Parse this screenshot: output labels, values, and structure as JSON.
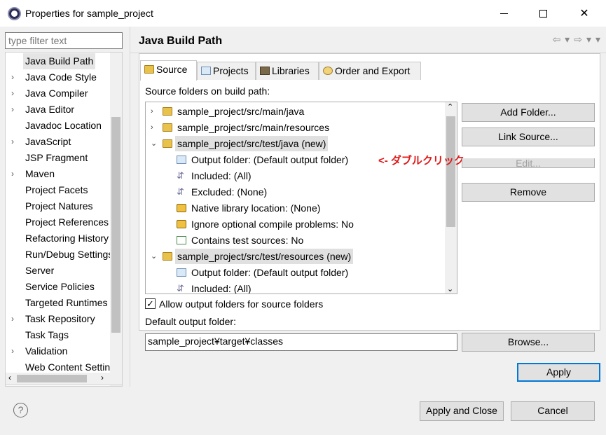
{
  "window": {
    "title": "Properties for sample_project",
    "minimize_icon": "minimize-icon",
    "maximize_icon": "maximize-icon",
    "close_icon": "close-icon"
  },
  "filter": {
    "placeholder": "type filter text"
  },
  "sidebar": {
    "items": [
      {
        "label": "Java Build Path",
        "expandable": false,
        "selected": true
      },
      {
        "label": "Java Code Style",
        "expandable": true
      },
      {
        "label": "Java Compiler",
        "expandable": true
      },
      {
        "label": "Java Editor",
        "expandable": true
      },
      {
        "label": "Javadoc Location",
        "expandable": false
      },
      {
        "label": "JavaScript",
        "expandable": true
      },
      {
        "label": "JSP Fragment",
        "expandable": false
      },
      {
        "label": "Maven",
        "expandable": true
      },
      {
        "label": "Project Facets",
        "expandable": false
      },
      {
        "label": "Project Natures",
        "expandable": false
      },
      {
        "label": "Project References",
        "expandable": false
      },
      {
        "label": "Refactoring History",
        "expandable": false
      },
      {
        "label": "Run/Debug Settings",
        "expandable": false
      },
      {
        "label": "Server",
        "expandable": false
      },
      {
        "label": "Service Policies",
        "expandable": false
      },
      {
        "label": "Targeted Runtimes",
        "expandable": false
      },
      {
        "label": "Task Repository",
        "expandable": true
      },
      {
        "label": "Task Tags",
        "expandable": false
      },
      {
        "label": "Validation",
        "expandable": true
      },
      {
        "label": "Web Content Settings",
        "expandable": false
      }
    ]
  },
  "page": {
    "title": "Java Build Path"
  },
  "tabs": [
    {
      "label": "Source",
      "active": true
    },
    {
      "label": "Projects"
    },
    {
      "label": "Libraries"
    },
    {
      "label": "Order and Export"
    }
  ],
  "source": {
    "section_label": "Source folders on build path:",
    "rows": [
      {
        "text": "sample_project/src/main/java",
        "level": 0,
        "expander": "›",
        "icon": "package-folder-icon"
      },
      {
        "text": "sample_project/src/main/resources",
        "level": 0,
        "expander": "›",
        "icon": "package-folder-icon"
      },
      {
        "text": "sample_project/src/test/java (new)",
        "level": 0,
        "expander": "⌄",
        "icon": "package-folder-icon",
        "highlighted": true
      },
      {
        "text": "Output folder: (Default output folder)",
        "level": 1,
        "icon": "output-folder-icon"
      },
      {
        "text": "Included: (All)",
        "level": 1,
        "icon": "filter-icon"
      },
      {
        "text": "Excluded: (None)",
        "level": 1,
        "icon": "filter-icon"
      },
      {
        "text": "Native library location: (None)",
        "level": 1,
        "icon": "native-library-icon"
      },
      {
        "text": "Ignore optional compile problems: No",
        "level": 1,
        "icon": "warning-ignore-icon"
      },
      {
        "text": "Contains test sources: No",
        "level": 1,
        "icon": "test-sources-icon"
      },
      {
        "text": "sample_project/src/test/resources (new)",
        "level": 0,
        "expander": "⌄",
        "icon": "package-folder-icon",
        "highlighted": true
      },
      {
        "text": "Output folder: (Default output folder)",
        "level": 1,
        "icon": "output-folder-icon"
      },
      {
        "text": "Included: (All)",
        "level": 1,
        "icon": "filter-icon"
      }
    ],
    "annotation": "<- ダブルクリック",
    "buttons": {
      "add_folder": "Add Folder...",
      "link_source": "Link Source...",
      "edit": "Edit...",
      "remove": "Remove"
    },
    "allow_output_label": "Allow output folders for source folders",
    "allow_output_checked": true,
    "default_output_label": "Default output folder:",
    "default_output_value": "sample_project¥target¥classes",
    "browse": "Browse..."
  },
  "footer": {
    "apply": "Apply",
    "apply_and_close": "Apply and Close",
    "cancel": "Cancel",
    "help_icon": "help-icon"
  }
}
